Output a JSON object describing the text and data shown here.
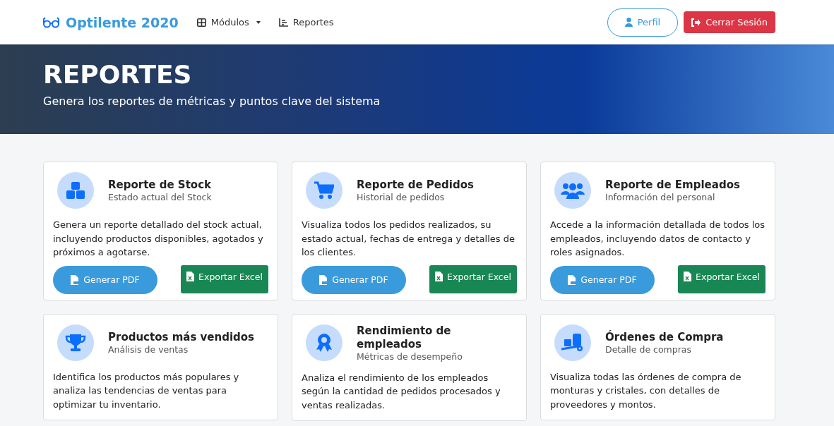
{
  "navbar": {
    "brand": "Optilente 2020",
    "links": [
      {
        "label": "Módulos",
        "kind": "dropdown"
      },
      {
        "label": "Reportes",
        "kind": "link"
      }
    ],
    "profile_button": "Perfil",
    "logout_button": "Cerrar Sesión"
  },
  "hero": {
    "title": "REPORTES",
    "subtitle": "Genera los reportes de métricas y puntos clave del sistema"
  },
  "cards": [
    {
      "title": "Reporte de Stock",
      "subtitle": "Estado actual del Stock",
      "description": "Genera un reporte detallado del stock actual, incluyendo productos disponibles, agotados y próximos a agotarse.",
      "buttons": [
        "Generar PDF",
        "Exportar Excel"
      ]
    },
    {
      "title": "Reporte de Pedidos",
      "subtitle": "Historial de pedidos",
      "description": "Visualiza todos los pedidos realizados, su estado actual, fechas de entrega y detalles de los clientes.",
      "buttons": [
        "Generar PDF",
        "Exportar Excel"
      ]
    },
    {
      "title": "Reporte de Empleados",
      "subtitle": "Información del personal",
      "description": "Accede a la información detallada de todos los empleados, incluyendo datos de contacto y roles asignados.",
      "buttons": [
        "Generar PDF",
        "Exportar Excel"
      ]
    },
    {
      "title": "Productos más vendidos",
      "subtitle": "Análisis de ventas",
      "description": "Identifica los productos más populares y analiza las tendencias de ventas para optimizar tu inventario."
    },
    {
      "title": "Rendimiento de empleados",
      "subtitle": "Métricas de desempeño",
      "description": "Analiza el rendimiento de los empleados según la cantidad de pedidos procesados y ventas realizadas."
    },
    {
      "title": "Órdenes de Compra",
      "subtitle": "Detalle de compras",
      "description": "Visualiza todas las órdenes de compra de monturas y cristales, con detalles de proveedores y montos."
    }
  ]
}
